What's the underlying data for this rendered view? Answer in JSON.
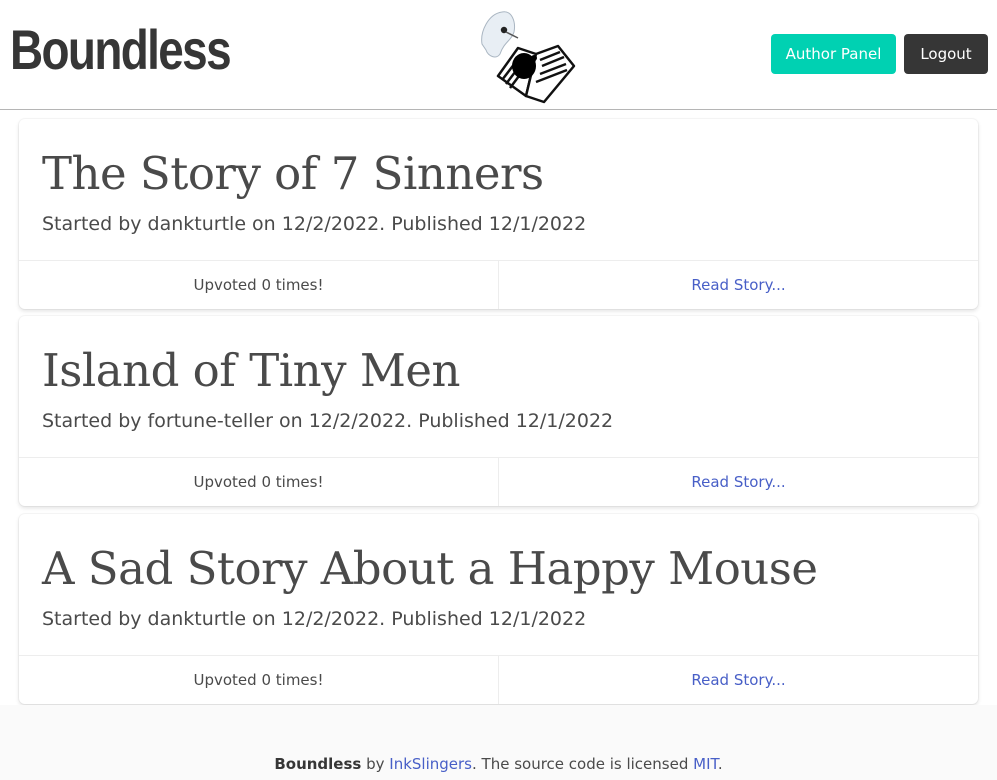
{
  "header": {
    "brand": "Boundless",
    "author_panel_label": "Author Panel",
    "logout_label": "Logout"
  },
  "stories": [
    {
      "title": "The Story of 7 Sinners",
      "byline": "Started by dankturtle on 12/2/2022. Published 12/1/2022",
      "upvotes": "Upvoted 0 times!",
      "read_label": "Read Story..."
    },
    {
      "title": "Island of Tiny Men",
      "byline": "Started by fortune-teller on 12/2/2022. Published 12/1/2022",
      "upvotes": "Upvoted 0 times!",
      "read_label": "Read Story..."
    },
    {
      "title": "A Sad Story About a Happy Mouse",
      "byline": "Started by dankturtle on 12/2/2022. Published 12/1/2022",
      "upvotes": "Upvoted 0 times!",
      "read_label": "Read Story..."
    }
  ],
  "footer": {
    "brand": "Boundless",
    "by": " by ",
    "team": "InkSlingers",
    "middle": ". The source code is licensed ",
    "license": "MIT",
    "end": "."
  },
  "colors": {
    "primary": "#00d1b2",
    "dark": "#363636",
    "link": "#485fc7"
  },
  "icons": {
    "logo": "ghost-with-book-logo"
  }
}
